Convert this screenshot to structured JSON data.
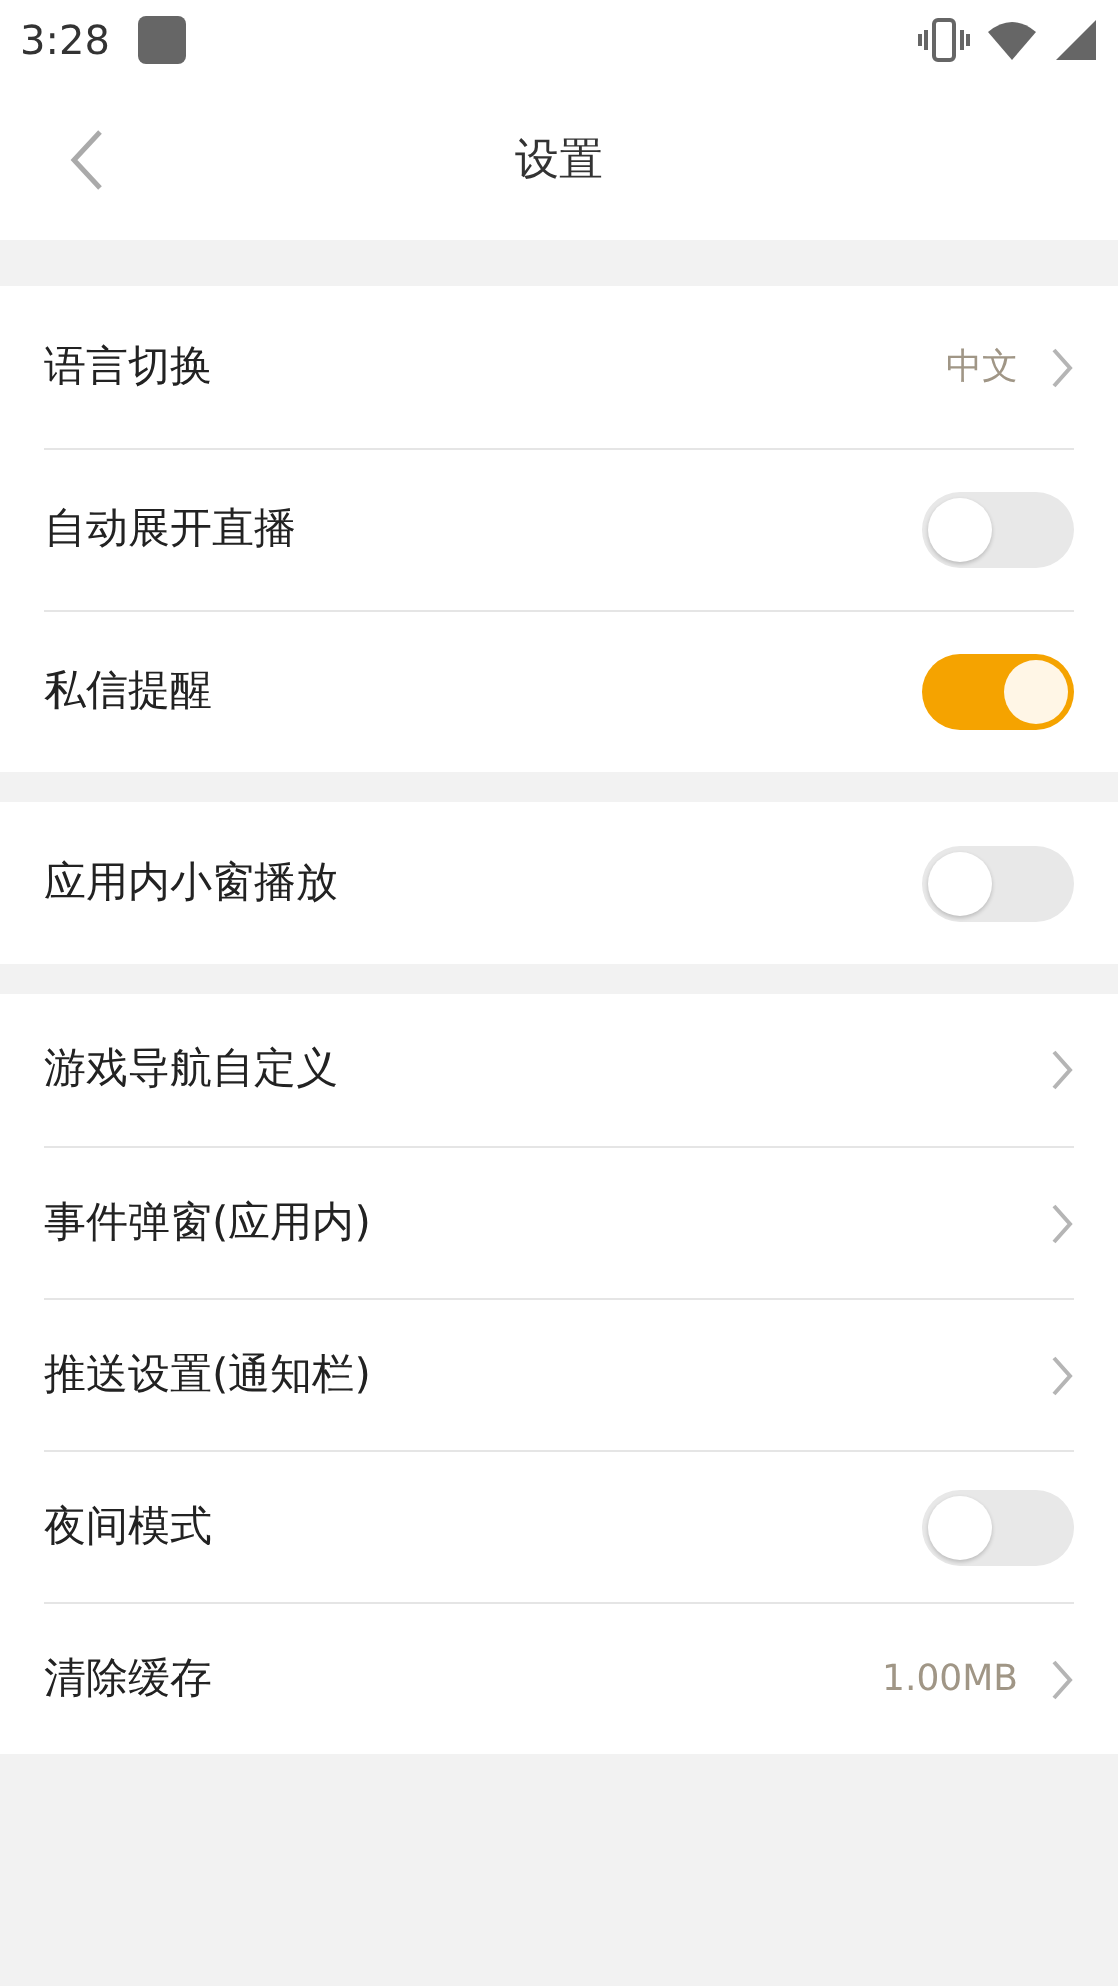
{
  "status_bar": {
    "time": "3:28"
  },
  "header": {
    "title": "设置"
  },
  "groups": [
    {
      "rows": [
        {
          "kind": "link",
          "label": "语言切换",
          "value": "中文"
        },
        {
          "kind": "toggle",
          "label": "自动展开直播",
          "on": false
        },
        {
          "kind": "toggle",
          "label": "私信提醒",
          "on": true
        }
      ]
    },
    {
      "rows": [
        {
          "kind": "toggle",
          "label": "应用内小窗播放",
          "on": false
        }
      ]
    },
    {
      "rows": [
        {
          "kind": "link",
          "label": "游戏导航自定义"
        },
        {
          "kind": "link",
          "label": "事件弹窗(应用内)"
        },
        {
          "kind": "link",
          "label": "推送设置(通知栏)"
        },
        {
          "kind": "toggle",
          "label": "夜间模式",
          "on": false
        },
        {
          "kind": "link",
          "label": "清除缓存",
          "value": "1.00MB"
        }
      ]
    }
  ]
}
